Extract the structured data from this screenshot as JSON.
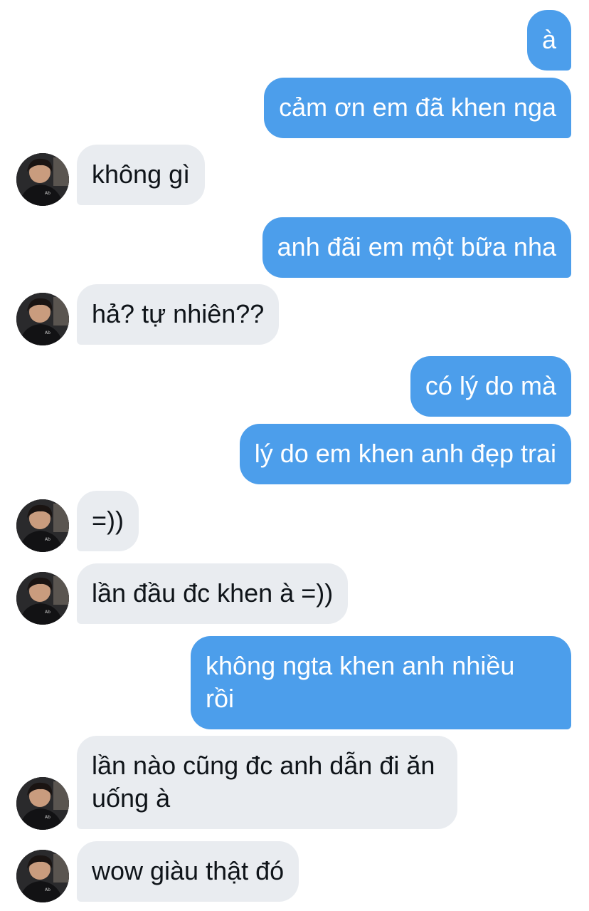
{
  "conversation": {
    "messages": [
      {
        "side": "out",
        "text": "à"
      },
      {
        "side": "out",
        "text": "cảm ơn em đã khen nga"
      },
      {
        "side": "in",
        "text": "không gì"
      },
      {
        "side": "out",
        "text": "anh đãi em một bữa nha"
      },
      {
        "side": "in",
        "text": "hả? tự nhiên??"
      },
      {
        "side": "out",
        "text": "có lý do mà"
      },
      {
        "side": "out",
        "text": "lý do em khen anh đẹp trai"
      },
      {
        "side": "in",
        "text": "=))"
      },
      {
        "side": "in",
        "text": "lần đầu đc khen à =))"
      },
      {
        "side": "out",
        "text": "không ngta khen anh nhiều rồi"
      },
      {
        "side": "in",
        "text": "lần nào cũng đc anh dẫn đi ăn uống à"
      },
      {
        "side": "in",
        "text": "wow giàu thật đó"
      }
    ]
  },
  "colors": {
    "outgoing_bubble": "#4c9eeb",
    "incoming_bubble": "#e9ecf0",
    "outgoing_text": "#ffffff",
    "incoming_text": "#0f1419"
  },
  "avatar_icon": "user-avatar-photo"
}
